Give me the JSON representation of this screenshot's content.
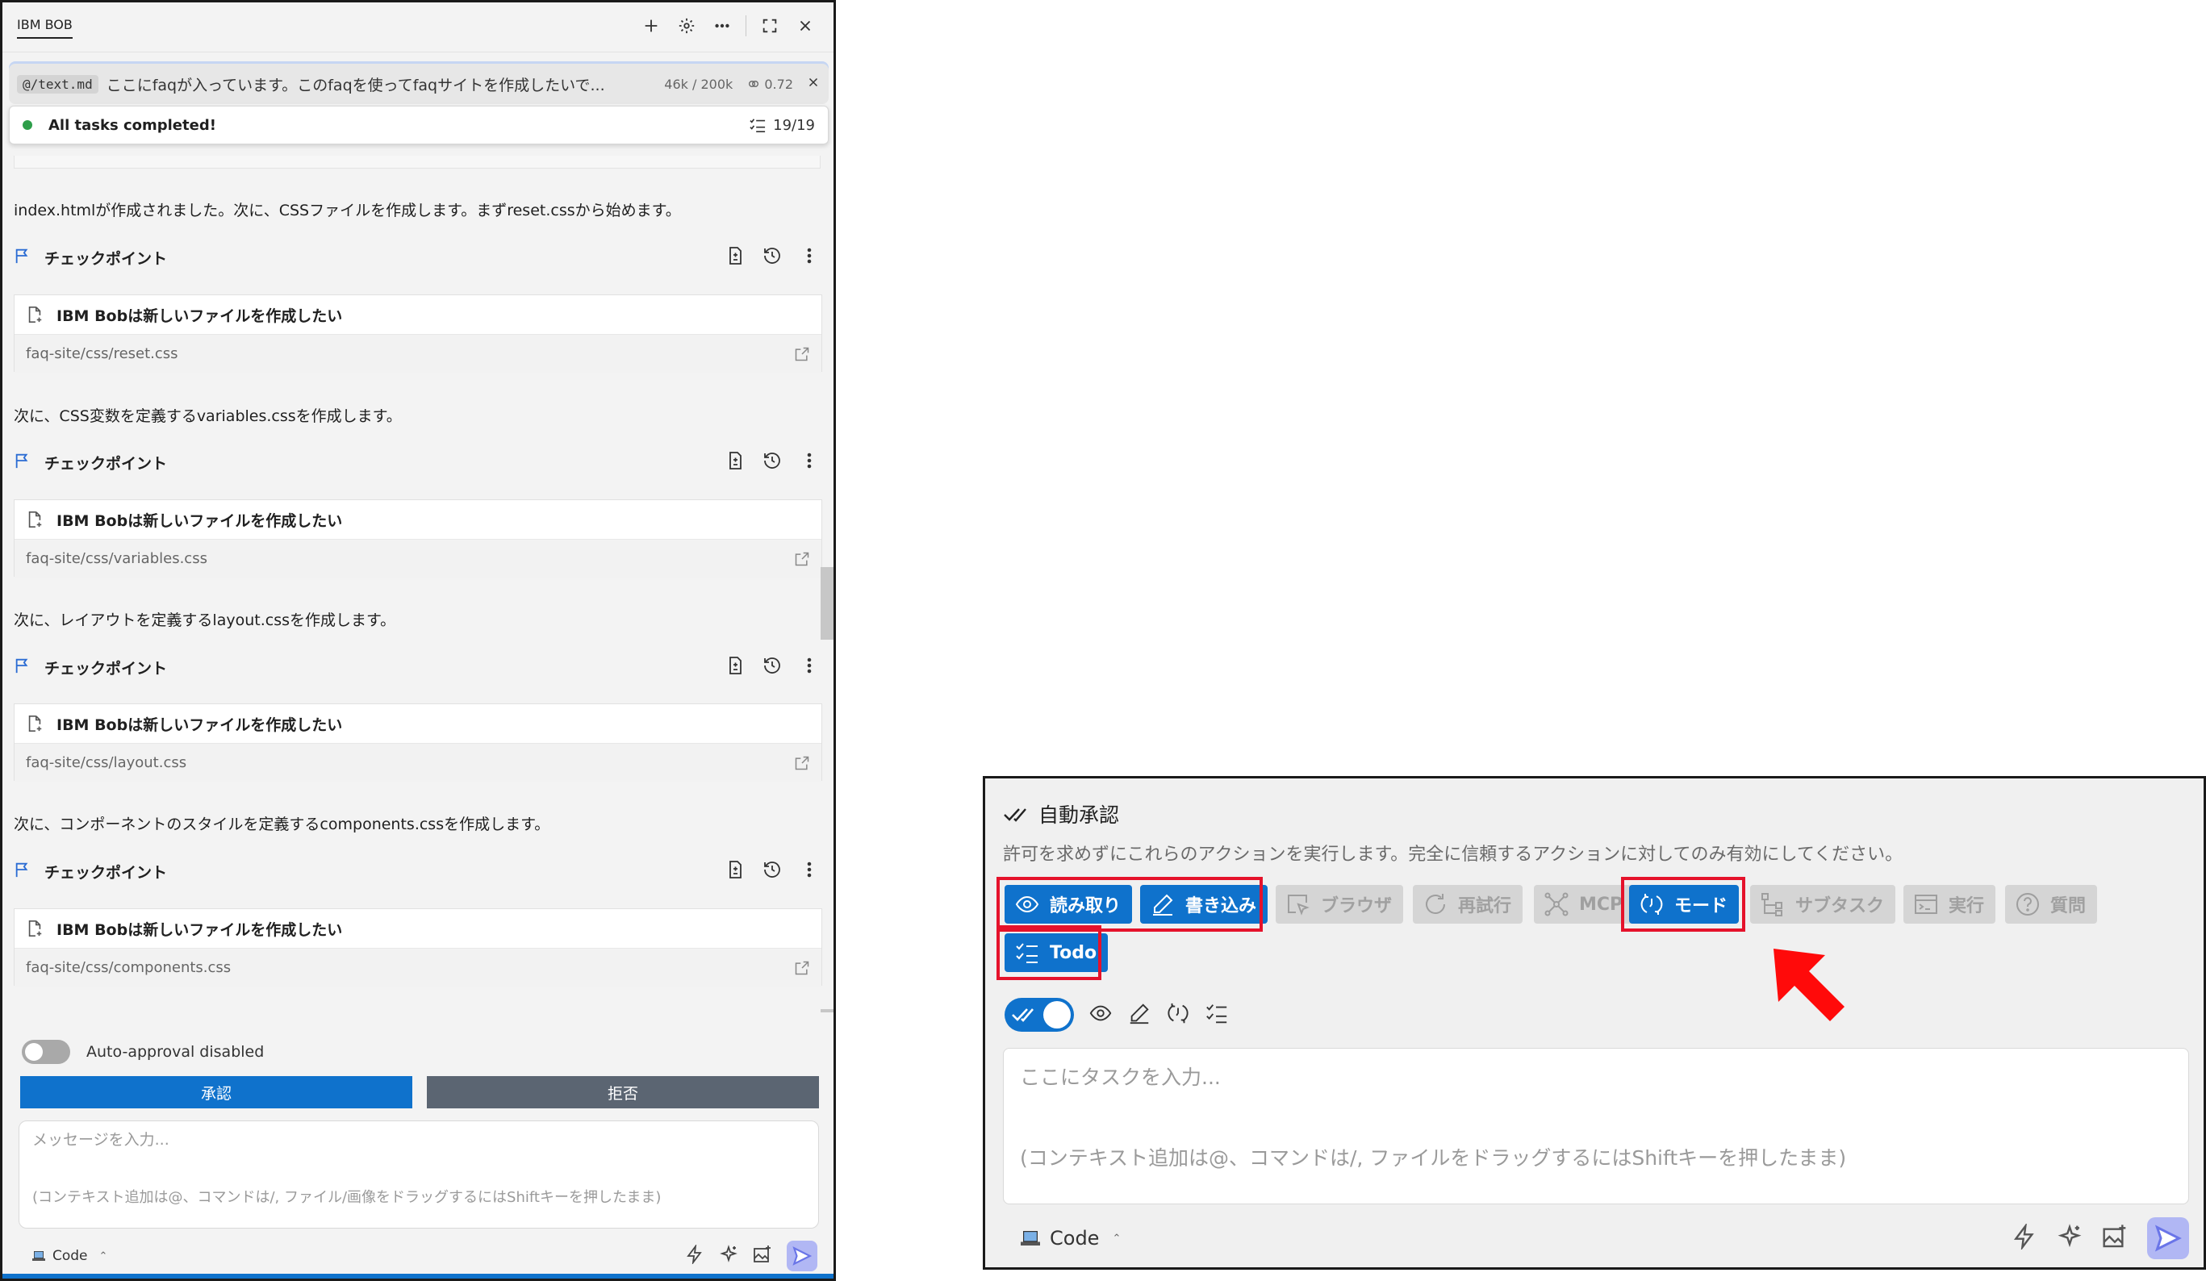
{
  "left": {
    "window_title": "IBM BOB",
    "task": {
      "file_tag": "@/text.md",
      "text": "ここにfaqが入っています。このfaqを使ってfaqサイトを作成したいで...",
      "tokens": "46k / 200k",
      "cost": "0.72"
    },
    "status": {
      "text": "All tasks completed!",
      "count": "19/19"
    },
    "messages": [
      "index.htmlが作成されました。次に、CSSファイルを作成します。まずreset.cssから始めます。",
      "次に、CSS変数を定義するvariables.cssを作成します。",
      "次に、レイアウトを定義するlayout.cssを作成します。",
      "次に、コンポーネントのスタイルを定義するcomponents.cssを作成します。"
    ],
    "checkpoint_label": "チェックポイント",
    "file_card_title": "IBM Bobは新しいファイルを作成したい",
    "files": [
      "faq-site/css/reset.css",
      "faq-site/css/variables.css",
      "faq-site/css/layout.css",
      "faq-site/css/components.css"
    ],
    "auto_approval_label": "Auto-approval disabled",
    "approve_label": "承認",
    "reject_label": "拒否",
    "input_placeholder": "メッセージを入力...",
    "input_hint": "(コンテキスト追加は@、コマンドは/, ファイル/画像をドラッグするにはShiftキーを押したまま)",
    "mode_label": "Code"
  },
  "right": {
    "title": "自動承認",
    "description": "許可を求めずにこれらのアクションを実行します。完全に信頼するアクションに対してのみ有効にしてください。",
    "chips": {
      "read": "読み取り",
      "write": "書き込み",
      "browser": "ブラウザ",
      "retry": "再試行",
      "mcp": "MCP",
      "mode": "モード",
      "subtask": "サブタスク",
      "execute": "実行",
      "question": "質問",
      "todo": "Todo"
    },
    "input_placeholder": "ここにタスクを入力...",
    "input_hint": "(コンテキスト追加は@、コマンドは/, ファイルをドラッグするにはShiftキーを押したまま)",
    "mode_label": "Code"
  },
  "colors": {
    "accent": "#0f72cc",
    "highlight": "#e5122b",
    "reject": "#5b6572"
  }
}
